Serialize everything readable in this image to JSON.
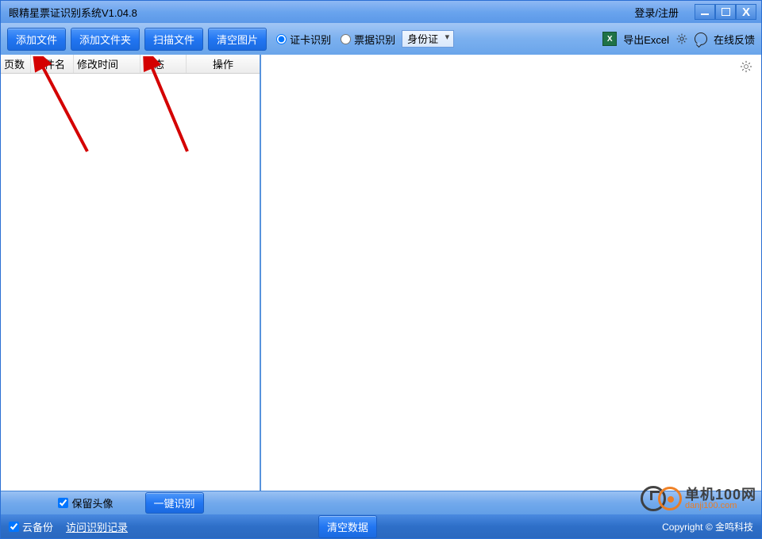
{
  "titlebar": {
    "title": "眼精星票证识别系统V1.04.8",
    "login": "登录/注册"
  },
  "toolbar": {
    "buttons": {
      "add_file": "添加文件",
      "add_folder": "添加文件夹",
      "scan_file": "扫描文件",
      "clear_images": "清空图片"
    },
    "radio_card": "证卡识别",
    "radio_bill": "票据识别",
    "doc_type": "身份证",
    "export_excel": "导出Excel",
    "feedback": "在线反馈"
  },
  "table": {
    "cols": {
      "page": "页数",
      "filename": "文件名",
      "mtime": "修改时间",
      "status": "状态",
      "action": "操作"
    }
  },
  "bottom1": {
    "keep_avatar": "保留头像",
    "recognize": "一键识别"
  },
  "bottom2": {
    "cloud_backup": "云备份",
    "visit_records": "访问识别记录",
    "clear_data": "清空数据",
    "copyright": "Copyright © 金鸣科技"
  },
  "watermark": {
    "cn": "单机100网",
    "en": "danji100.com"
  }
}
